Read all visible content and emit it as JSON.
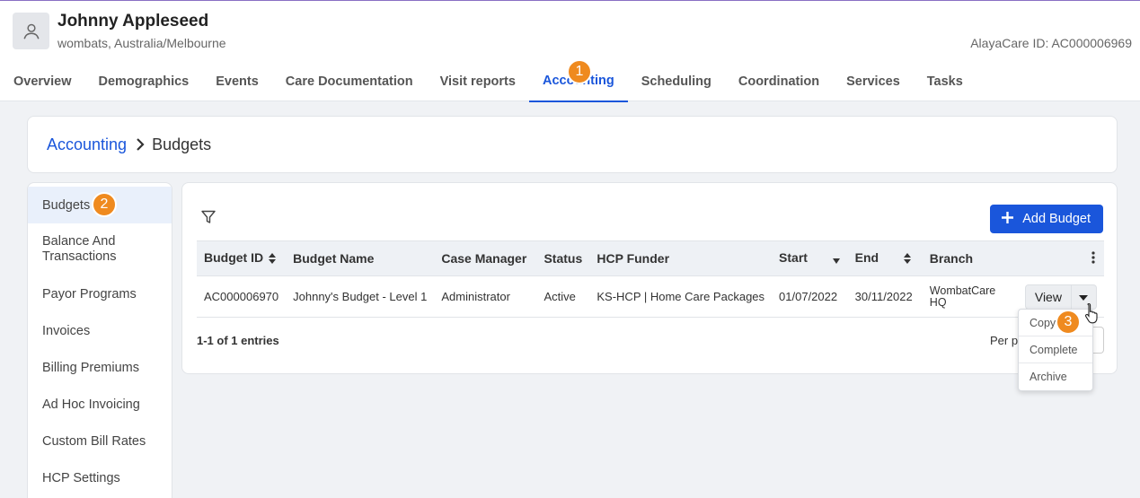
{
  "header": {
    "client_name": "Johnny Appleseed",
    "client_subtitle": "wombats, Australia/Melbourne",
    "alayacare_id": "AlayaCare ID: AC000006969"
  },
  "tabs": [
    {
      "label": "Overview"
    },
    {
      "label": "Demographics"
    },
    {
      "label": "Events"
    },
    {
      "label": "Care Documentation"
    },
    {
      "label": "Visit reports"
    },
    {
      "label": "Accounting",
      "active": true
    },
    {
      "label": "Scheduling"
    },
    {
      "label": "Coordination"
    },
    {
      "label": "Services"
    },
    {
      "label": "Tasks"
    }
  ],
  "callouts": {
    "one": "1",
    "two": "2",
    "three": "3"
  },
  "breadcrumb": {
    "parent": "Accounting",
    "current": "Budgets"
  },
  "sidebar": {
    "items": [
      {
        "label": "Budgets"
      },
      {
        "label": "Balance And Transactions"
      },
      {
        "label": "Payor Programs"
      },
      {
        "label": "Invoices"
      },
      {
        "label": "Billing Premiums"
      },
      {
        "label": "Ad Hoc Invoicing"
      },
      {
        "label": "Custom Bill Rates"
      },
      {
        "label": "HCP Settings"
      }
    ]
  },
  "toolbar": {
    "add_label": "Add Budget"
  },
  "table": {
    "columns": [
      "Budget ID",
      "Budget Name",
      "Case Manager",
      "Status",
      "HCP Funder",
      "Start",
      "End",
      "Branch"
    ],
    "row": {
      "budget_id": "AC000006970",
      "budget_name": "Johnny's Budget - Level 1",
      "case_manager": "Administrator",
      "status": "Active",
      "hcp_funder": "KS-HCP | Home Care Packages",
      "start": "01/07/2022",
      "end": "30/11/2022",
      "branch_line1": "WombatCare",
      "branch_line2": "HQ",
      "view_label": "View"
    }
  },
  "footer": {
    "entries": "1-1 of 1 entries",
    "per_page": "Per pa"
  },
  "row_menu": {
    "copy": "Copy",
    "complete": "Complete",
    "archive": "Archive"
  },
  "colors": {
    "accent": "#1a56db",
    "badge": "#ef8a1f"
  }
}
